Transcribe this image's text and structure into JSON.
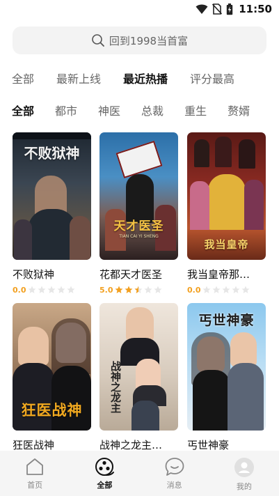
{
  "status_bar": {
    "time": "11:50",
    "icons": [
      "wifi-icon",
      "no-sim-icon",
      "battery-charging-icon"
    ]
  },
  "search": {
    "placeholder": "回到1998当首富",
    "icon": "search-icon"
  },
  "sort_tabs": [
    {
      "label": "全部",
      "active": false
    },
    {
      "label": "最新上线",
      "active": false
    },
    {
      "label": "最近热播",
      "active": true
    },
    {
      "label": "评分最高",
      "active": false
    }
  ],
  "genre_tabs": [
    {
      "label": "全部",
      "active": true
    },
    {
      "label": "都市",
      "active": false
    },
    {
      "label": "神医",
      "active": false
    },
    {
      "label": "总裁",
      "active": false
    },
    {
      "label": "重生",
      "active": false
    },
    {
      "label": "赘婿",
      "active": false
    }
  ],
  "dramas": [
    {
      "title": "不败狱神",
      "poster_text": "不败狱神",
      "rating": "0.0",
      "stars": 0
    },
    {
      "title": "花都天才医圣",
      "poster_text": "天才医圣",
      "poster_subtext": "TIAN CAI YI SHENG",
      "rating": "5.0",
      "stars": 2.5
    },
    {
      "title": "我当皇帝那…",
      "poster_text": "我当皇帝",
      "rating": "0.0",
      "stars": 0
    },
    {
      "title": "狂医战神",
      "poster_text": "狂医战神",
      "rating": "",
      "stars": null
    },
    {
      "title": "战神之龙主…",
      "poster_text": "战神之龙主",
      "rating": "",
      "stars": null
    },
    {
      "title": "丐世神豪",
      "poster_text": "丐世神豪",
      "rating": "",
      "stars": null
    }
  ],
  "colors": {
    "accent_star": "#f2a020",
    "empty_star": "#e6e6e6",
    "nav_bg": "#f5f5f5"
  },
  "bottom_nav": [
    {
      "label": "首页",
      "icon": "home-icon",
      "active": false
    },
    {
      "label": "全部",
      "icon": "film-reel-icon",
      "active": true
    },
    {
      "label": "消息",
      "icon": "message-bubble-icon",
      "active": false
    },
    {
      "label": "我的",
      "icon": "profile-avatar-icon",
      "active": false
    }
  ]
}
